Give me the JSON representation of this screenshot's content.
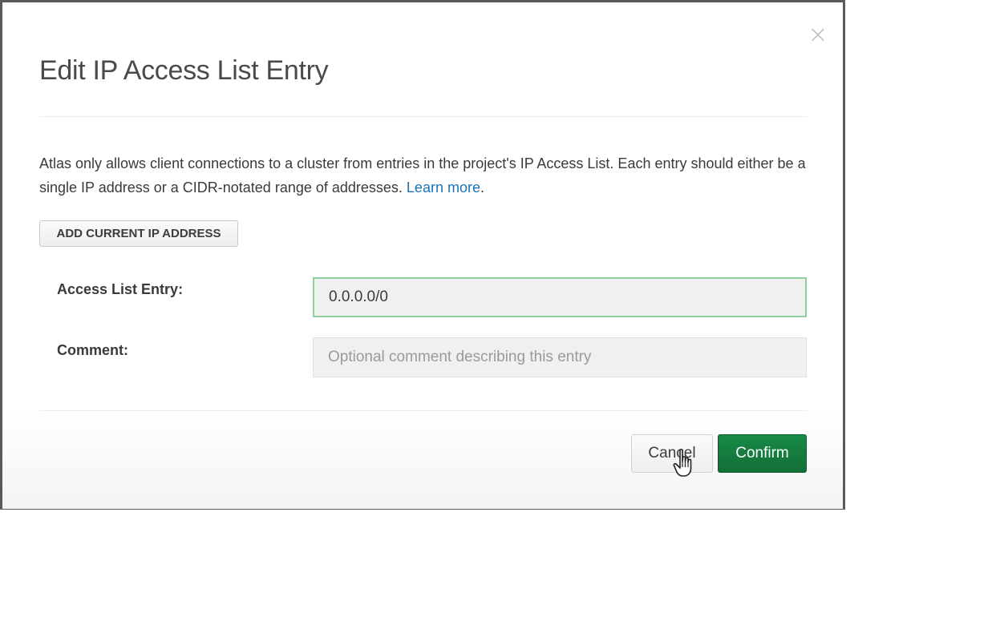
{
  "modal": {
    "title": "Edit IP Access List Entry",
    "close_symbol": "×",
    "description_text": "Atlas only allows client connections to a cluster from entries in the project's IP Access List. Each entry should either be a single IP address or a CIDR-notated range of addresses. ",
    "learn_more_link": "Learn more",
    "description_end": ".",
    "add_current_ip_label": "ADD CURRENT IP ADDRESS"
  },
  "form": {
    "access_list_label": "Access List Entry:",
    "access_list_value": "0.0.0.0/0",
    "comment_label": "Comment:",
    "comment_placeholder": "Optional comment describing this entry",
    "comment_value": ""
  },
  "footer": {
    "cancel_label": "Cancel",
    "confirm_label": "Confirm"
  },
  "colors": {
    "confirm_green": "#136e38",
    "link_blue": "#1a73b5",
    "focus_border": "#8fd19e"
  },
  "icons": {
    "close": "close-icon",
    "pointer": "hand-pointer-icon"
  }
}
